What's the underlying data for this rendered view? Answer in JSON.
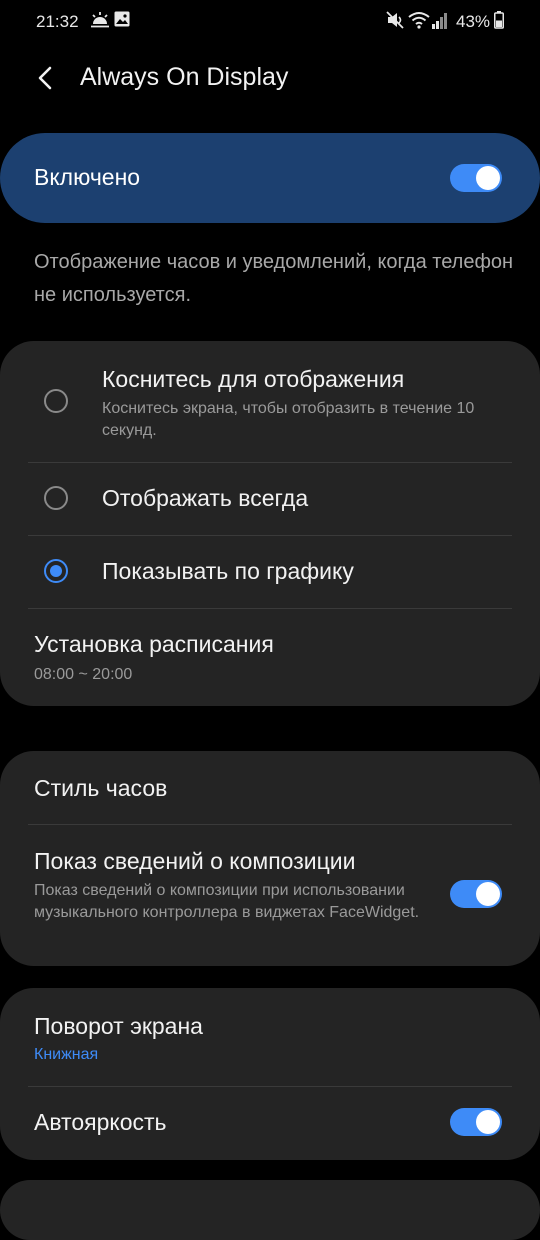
{
  "status_bar": {
    "time": "21:32",
    "left_icons": [
      "weather-icon",
      "image-icon"
    ],
    "right_icons": [
      "mute-icon",
      "wifi-icon",
      "signal-icon",
      "battery-icon"
    ],
    "battery_percent": "43%"
  },
  "header": {
    "title": "Always On Display",
    "back_icon": "back-arrow-icon"
  },
  "master_switch": {
    "label": "Включено",
    "on": true
  },
  "description": "Отображение часов и уведомлений, когда телефон не используется.",
  "display_mode": {
    "options": [
      {
        "title": "Коснитесь для отображения",
        "subtitle": "Коснитесь экрана, чтобы отобразить в течение 10 секунд.",
        "selected": false
      },
      {
        "title": "Отображать всегда",
        "subtitle": "",
        "selected": false
      },
      {
        "title": "Показывать по графику",
        "subtitle": "",
        "selected": true
      }
    ],
    "schedule": {
      "title": "Установка расписания",
      "value": "08:00 ~ 20:00"
    }
  },
  "style_group": {
    "clock_style": {
      "title": "Стиль часов"
    },
    "music_info": {
      "title": "Показ сведений о композиции",
      "subtitle": "Показ сведений о композиции при использовании музыкального контроллера в виджетах FaceWidget.",
      "on": true
    }
  },
  "screen_group": {
    "rotation": {
      "title": "Поворот экрана",
      "value": "Книжная"
    },
    "auto_brightness": {
      "title": "Автояркость",
      "on": true
    }
  },
  "colors": {
    "accent": "#3e8bf7",
    "master_card": "#1c4070",
    "card": "#242424",
    "background": "#000000"
  }
}
